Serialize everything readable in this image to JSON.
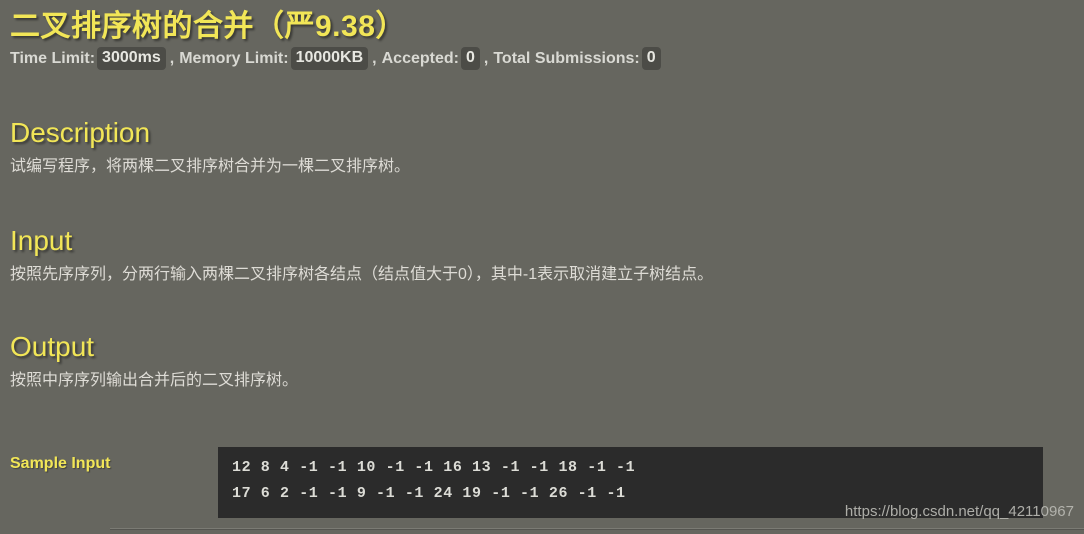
{
  "problem": {
    "title_cn": "二叉排序树的合并",
    "title_suffix": "（严9.38）",
    "meta": {
      "time_limit_label": "Time Limit:",
      "time_limit_value": "3000ms",
      "memory_limit_label": "Memory Limit:",
      "memory_limit_value": "10000KB",
      "accepted_label": "Accepted:",
      "accepted_value": "0",
      "submissions_label": "Total Submissions:",
      "submissions_value": "0",
      "comma": ","
    }
  },
  "sections": {
    "description": {
      "heading": "Description",
      "body": "试编写程序，将两棵二叉排序树合并为一棵二叉排序树。"
    },
    "input": {
      "heading": "Input",
      "body": "按照先序序列，分两行输入两棵二叉排序树各结点（结点值大于0），其中-1表示取消建立子树结点。"
    },
    "output": {
      "heading": "Output",
      "body": "按照中序序列输出合并后的二叉排序树。"
    }
  },
  "sample": {
    "label": "Sample Input",
    "lines": [
      "12 8 4 -1 -1 10 -1 -1 16 13 -1 -1 18 -1 -1",
      "17 6 2 -1 -1 9 -1 -1 24 19 -1 -1 26 -1 -1"
    ]
  },
  "watermark": {
    "text": "https://blog.csdn.net/qq_42110967"
  },
  "colors": {
    "background": "#66665f",
    "accent_yellow": "#f2e657",
    "body_text": "#dedcd6",
    "badge_bg": "#4c4c47",
    "code_bg": "#2b2b2b",
    "code_text": "#dcdcd6"
  }
}
